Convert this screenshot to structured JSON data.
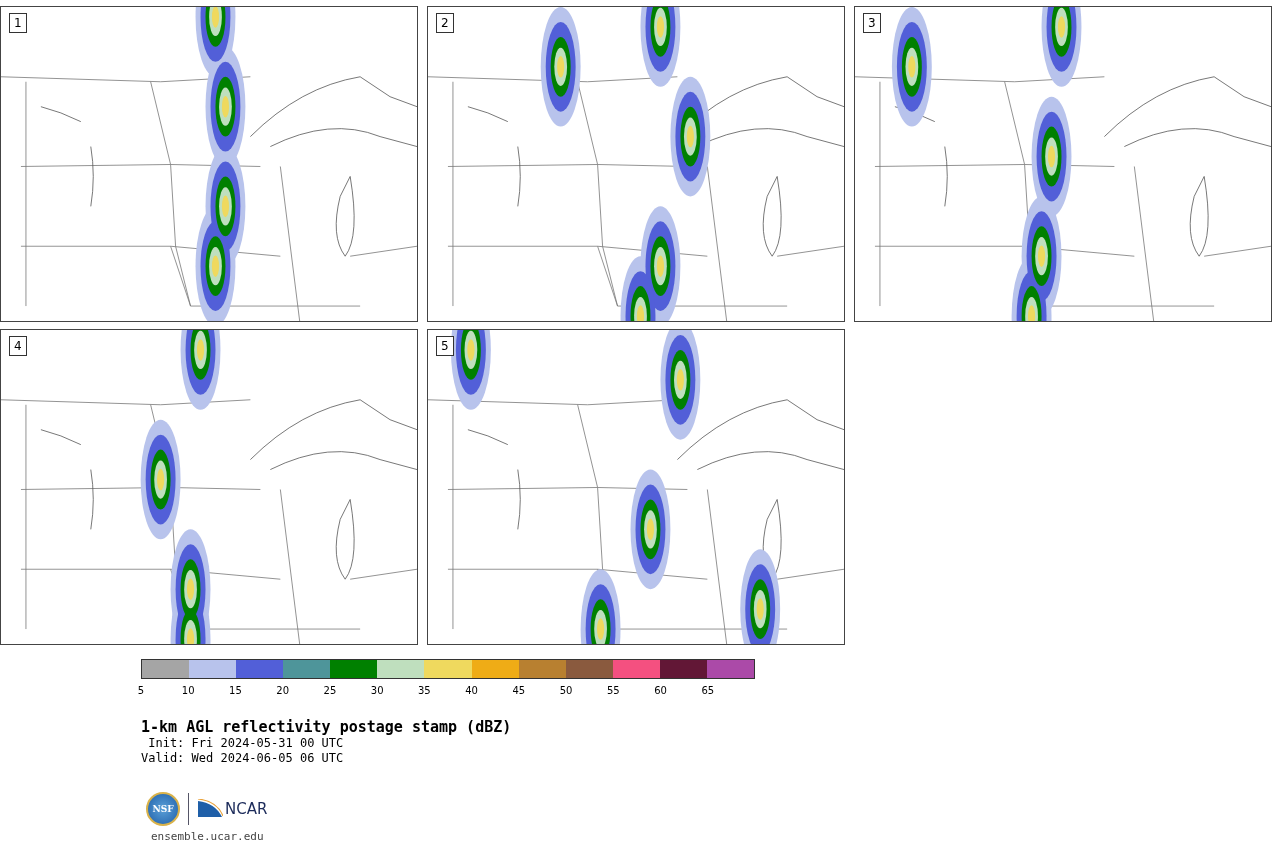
{
  "panels": [
    {
      "label": "1"
    },
    {
      "label": "2"
    },
    {
      "label": "3"
    },
    {
      "label": "4"
    },
    {
      "label": "5"
    }
  ],
  "colorbar": {
    "segments": [
      {
        "color": "#a5a5a5"
      },
      {
        "color": "#b8c3ec"
      },
      {
        "color": "#525fd8"
      },
      {
        "color": "#4e959a"
      },
      {
        "color": "#008000"
      },
      {
        "color": "#bfdfbe"
      },
      {
        "color": "#efd95e"
      },
      {
        "color": "#efac16"
      },
      {
        "color": "#b88030"
      },
      {
        "color": "#8a5a3e"
      },
      {
        "color": "#f45080"
      },
      {
        "color": "#621736"
      },
      {
        "color": "#ab4aa8"
      }
    ],
    "ticks": [
      "5",
      "10",
      "15",
      "20",
      "25",
      "30",
      "35",
      "40",
      "45",
      "50",
      "55",
      "60",
      "65"
    ]
  },
  "title": "1-km AGL reflectivity postage stamp (dBZ)",
  "init": " Init: Fri 2024-05-31 00 UTC",
  "valid": "Valid: Wed 2024-06-05 06 UTC",
  "logos": {
    "nsf": "NSF",
    "ncar": "NCAR"
  },
  "site": "ensemble.ucar.edu"
}
